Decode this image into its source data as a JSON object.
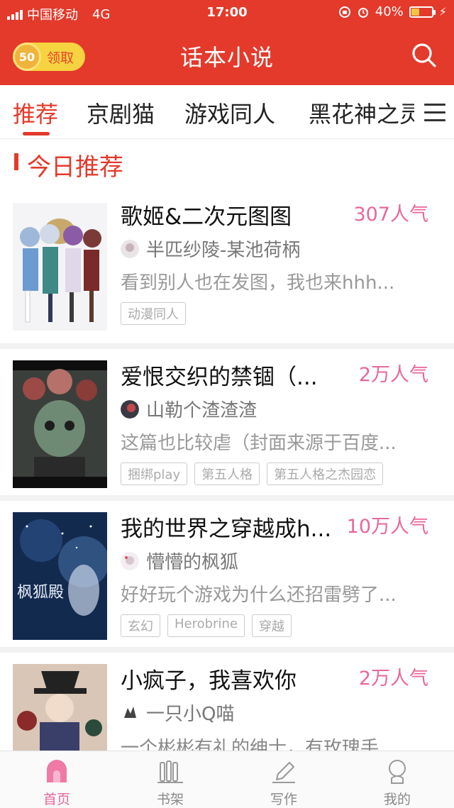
{
  "status_bar": {
    "carrier": "中国移动",
    "network": "4G",
    "time": "17:00",
    "battery": "40%",
    "battery_level": 0.4
  },
  "header": {
    "reward_coins": "50",
    "reward_label": "领取",
    "title": "话本小说",
    "search_icon": "search-icon"
  },
  "tabs": [
    {
      "label": "推荐"
    },
    {
      "label": "京剧猫"
    },
    {
      "label": "游戏同人"
    },
    {
      "label": "黑花神之灵"
    }
  ],
  "section": {
    "title": "今日推荐"
  },
  "books": [
    {
      "title": "歌姬&二次元图图",
      "popularity": "307人气",
      "author": "半匹纱陵-某池荷柄",
      "desc": "看到别人也在发图，我也来hhh...",
      "tags": [
        "动漫同人"
      ]
    },
    {
      "title": "爱恨交织的禁锢（...",
      "popularity": "2万人气",
      "author": "山勒个渣渣渣",
      "desc": "这篇也比较虐（封面来源于百度...",
      "tags": [
        "捆绑play",
        "第五人格",
        "第五人格之杰园恋"
      ]
    },
    {
      "title": "我的世界之穿越成h...",
      "popularity": "10万人气",
      "author": "懵懵的枫狐",
      "desc": "好好玩个游戏为什么还招雷劈了...",
      "tags": [
        "玄幻",
        "Herobrine",
        "穿越"
      ],
      "cover_text": "枫狐殿"
    },
    {
      "title": "小疯子，我喜欢你",
      "popularity": "2万人气",
      "author": "一只小Q喵",
      "desc": "一个彬彬有礼的绅士，有玫瑰手...",
      "tags": []
    }
  ],
  "tabbar": [
    {
      "label": "首页",
      "icon": "home-icon",
      "active": true
    },
    {
      "label": "书架",
      "icon": "bookshelf-icon",
      "active": false
    },
    {
      "label": "写作",
      "icon": "pen-icon",
      "active": false
    },
    {
      "label": "我的",
      "icon": "profile-icon",
      "active": false
    }
  ],
  "colors": {
    "brand_red": "#e33a2b",
    "popularity_pink": "#e8679b",
    "coin_yellow": "#f6d340"
  }
}
